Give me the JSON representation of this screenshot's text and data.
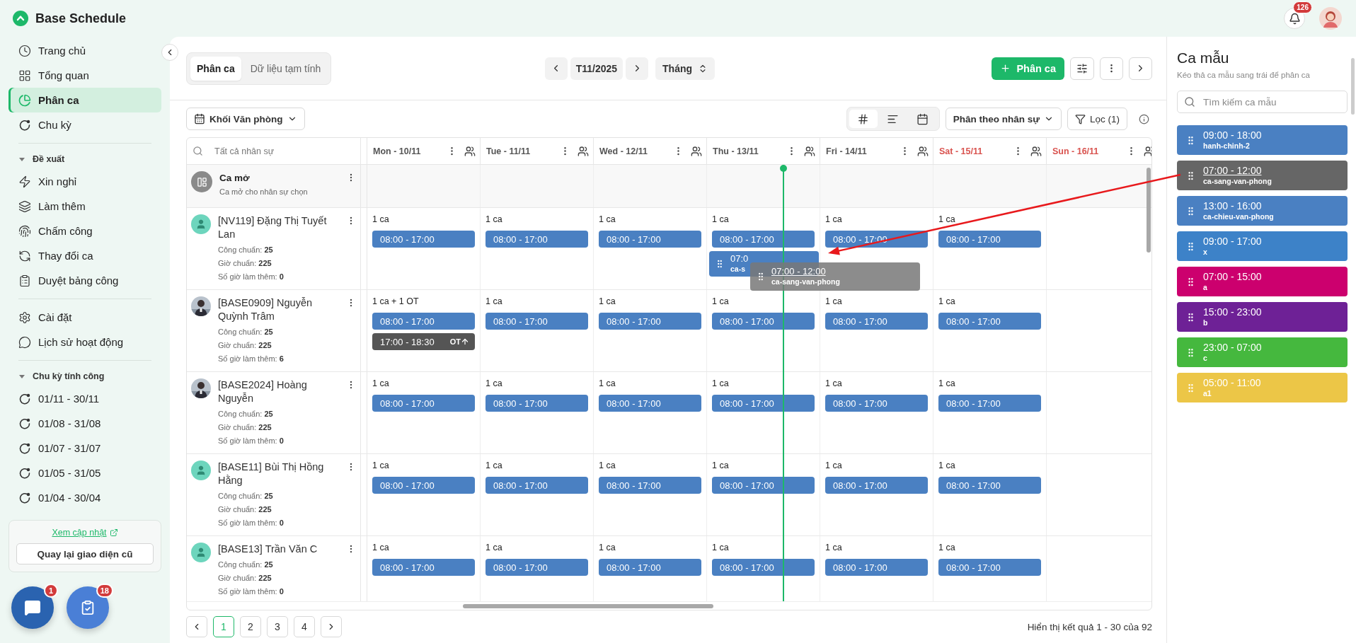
{
  "header": {
    "logo": "Base Schedule",
    "notifications": "126"
  },
  "sidebar": {
    "sections": [
      {
        "items": [
          {
            "label": "Trang chủ",
            "kind": "clock",
            "selected": false
          },
          {
            "label": "Tổng quan",
            "kind": "grid",
            "selected": false
          },
          {
            "label": "Phân ca",
            "kind": "pie",
            "selected": true
          },
          {
            "label": "Chu kỳ",
            "kind": "cycle",
            "selected": false
          }
        ]
      },
      {
        "heading": "Đề xuất",
        "expanded": true,
        "items": [
          {
            "label": "Xin nghỉ",
            "kind": "zap",
            "selected": false
          },
          {
            "label": "Làm thêm",
            "kind": "layers",
            "selected": false
          },
          {
            "label": "Chấm công",
            "kind": "id",
            "selected": false
          },
          {
            "label": "Thay đổi ca",
            "kind": "swap",
            "selected": false
          },
          {
            "label": "Duyệt bảng công",
            "kind": "sheet",
            "selected": false
          }
        ]
      },
      {
        "items": [
          {
            "label": "Cài đặt",
            "kind": "gear",
            "selected": false
          },
          {
            "label": "Lịch sử hoạt động",
            "kind": "chat",
            "selected": false
          }
        ]
      },
      {
        "heading": "Chu kỳ tính công",
        "expanded": true,
        "items": [
          {
            "label": "01/11 - 30/11",
            "kind": "cycle",
            "selected": false
          },
          {
            "label": "01/08 - 31/08",
            "kind": "cycle",
            "selected": false
          },
          {
            "label": "01/07 - 31/07",
            "kind": "cycle",
            "selected": false
          },
          {
            "label": "01/05 - 31/05",
            "kind": "cycle",
            "selected": false
          },
          {
            "label": "01/04 - 30/04",
            "kind": "cycle",
            "selected": false
          }
        ]
      }
    ],
    "update_box": {
      "link": "Xem cập nhật",
      "button": "Quay lại giao diện cũ"
    },
    "fabs": [
      {
        "kind": "chat",
        "badge": "1"
      },
      {
        "kind": "tasks",
        "badge": "18"
      }
    ]
  },
  "toolbar": {
    "tabs": [
      {
        "label": "Phân ca",
        "selected": true
      },
      {
        "label": "Dữ liệu tạm tính",
        "selected": false
      }
    ],
    "period": "T11/2025",
    "view": "Tháng",
    "add_button": "Phân ca"
  },
  "filters": {
    "group": "Khối Văn phòng",
    "view_modes": [
      {
        "kind": "grid",
        "selected": true
      },
      {
        "kind": "timeline",
        "selected": false
      },
      {
        "kind": "calendar",
        "selected": false
      }
    ],
    "assign_mode": "Phân theo nhân sự",
    "filter": "Lọc (1)"
  },
  "grid": {
    "search_placeholder": "Tất cả nhân sự",
    "days": [
      {
        "label": "Mon - 10/11",
        "weekend": false
      },
      {
        "label": "Tue - 11/11",
        "weekend": false
      },
      {
        "label": "Wed - 12/11",
        "weekend": false
      },
      {
        "label": "Thu - 13/11",
        "weekend": false
      },
      {
        "label": "Fri - 14/11",
        "weekend": false
      },
      {
        "label": "Sat - 15/11",
        "weekend": true
      },
      {
        "label": "Sun - 16/11",
        "weekend": true
      }
    ],
    "open_shift": {
      "title": "Ca mở",
      "subtitle": "Ca mở cho nhân sự chọn"
    },
    "employees": [
      {
        "name": "[NV119] Đặng Thị Tuyết Lan",
        "kind": "icon",
        "stats": [
          {
            "label": "Công chuẩn:",
            "value": "25"
          },
          {
            "label": "Giờ chuẩn:",
            "value": "225"
          },
          {
            "label": "Số giờ làm thêm:",
            "value": "0"
          }
        ],
        "cells": [
          {
            "summary": "1 ca",
            "shifts": [
              {
                "kind": "regular",
                "time": "08:00 - 17:00"
              }
            ]
          },
          {
            "summary": "1 ca",
            "shifts": [
              {
                "kind": "regular",
                "time": "08:00 - 17:00"
              }
            ]
          },
          {
            "summary": "1 ca",
            "shifts": [
              {
                "kind": "regular",
                "time": "08:00 - 17:00"
              }
            ]
          },
          {
            "summary": "1 ca",
            "shifts": [
              {
                "kind": "regular",
                "time": "08:00 - 17:00"
              },
              {
                "kind": "drop",
                "time": "07:0",
                "code": "ca-s"
              }
            ]
          },
          {
            "summary": "1 ca",
            "shifts": [
              {
                "kind": "regular",
                "time": "08:00 - 17:00"
              }
            ]
          },
          {
            "summary": "1 ca",
            "shifts": [
              {
                "kind": "regular",
                "time": "08:00 - 17:00"
              }
            ]
          }
        ]
      },
      {
        "name": "[BASE0909] Nguyễn Quỳnh Trâm",
        "stats": [
          {
            "label": "Công chuẩn:",
            "value": "25"
          },
          {
            "label": "Giờ chuẩn:",
            "value": "225"
          },
          {
            "label": "Số giờ làm thêm:",
            "value": "6"
          }
        ],
        "cells": [
          {
            "summary": "1 ca + 1 OT",
            "shifts": [
              {
                "kind": "regular",
                "time": "08:00 - 17:00"
              },
              {
                "kind": "ot",
                "time": "17:00 - 18:30",
                "badge": "OT"
              }
            ]
          },
          {
            "summary": "1 ca",
            "shifts": [
              {
                "kind": "regular",
                "time": "08:00 - 17:00"
              }
            ]
          },
          {
            "summary": "1 ca",
            "shifts": [
              {
                "kind": "regular",
                "time": "08:00 - 17:00"
              }
            ]
          },
          {
            "summary": "1 ca",
            "shifts": [
              {
                "kind": "regular",
                "time": "08:00 - 17:00"
              }
            ]
          },
          {
            "summary": "1 ca",
            "shifts": [
              {
                "kind": "regular",
                "time": "08:00 - 17:00"
              }
            ]
          },
          {
            "summary": "1 ca",
            "shifts": [
              {
                "kind": "regular",
                "time": "08:00 - 17:00"
              }
            ]
          }
        ]
      },
      {
        "name": "[BASE2024] Hoàng Nguyễn",
        "stats": [
          {
            "label": "Công chuẩn:",
            "value": "25"
          },
          {
            "label": "Giờ chuẩn:",
            "value": "225"
          },
          {
            "label": "Số giờ làm thêm:",
            "value": "0"
          }
        ],
        "cells": [
          {
            "summary": "1 ca",
            "shifts": [
              {
                "kind": "regular",
                "time": "08:00 - 17:00"
              }
            ]
          },
          {
            "summary": "1 ca",
            "shifts": [
              {
                "kind": "regular",
                "time": "08:00 - 17:00"
              }
            ]
          },
          {
            "summary": "1 ca",
            "shifts": [
              {
                "kind": "regular",
                "time": "08:00 - 17:00"
              }
            ]
          },
          {
            "summary": "1 ca",
            "shifts": [
              {
                "kind": "regular",
                "time": "08:00 - 17:00"
              }
            ]
          },
          {
            "summary": "1 ca",
            "shifts": [
              {
                "kind": "regular",
                "time": "08:00 - 17:00"
              }
            ]
          },
          {
            "summary": "1 ca",
            "shifts": [
              {
                "kind": "regular",
                "time": "08:00 - 17:00"
              }
            ]
          }
        ]
      },
      {
        "name": "[BASE11] Bùi Thị Hồng Hằng",
        "kind": "icon",
        "stats": [
          {
            "label": "Công chuẩn:",
            "value": "25"
          },
          {
            "label": "Giờ chuẩn:",
            "value": "225"
          },
          {
            "label": "Số giờ làm thêm:",
            "value": "0"
          }
        ],
        "cells": [
          {
            "summary": "1 ca",
            "shifts": [
              {
                "kind": "regular",
                "time": "08:00 - 17:00"
              }
            ]
          },
          {
            "summary": "1 ca",
            "shifts": [
              {
                "kind": "regular",
                "time": "08:00 - 17:00"
              }
            ]
          },
          {
            "summary": "1 ca",
            "shifts": [
              {
                "kind": "regular",
                "time": "08:00 - 17:00"
              }
            ]
          },
          {
            "summary": "1 ca",
            "shifts": [
              {
                "kind": "regular",
                "time": "08:00 - 17:00"
              }
            ]
          },
          {
            "summary": "1 ca",
            "shifts": [
              {
                "kind": "regular",
                "time": "08:00 - 17:00"
              }
            ]
          },
          {
            "summary": "1 ca",
            "shifts": [
              {
                "kind": "regular",
                "time": "08:00 - 17:00"
              }
            ]
          }
        ]
      },
      {
        "name": "[BASE13] Trần Văn C",
        "kind": "icon",
        "stats": [
          {
            "label": "Công chuẩn:",
            "value": "25"
          },
          {
            "label": "Giờ chuẩn:",
            "value": "225"
          },
          {
            "label": "Số giờ làm thêm:",
            "value": "0"
          }
        ],
        "cells": [
          {
            "summary": "1 ca",
            "shifts": [
              {
                "kind": "regular",
                "time": "08:00 - 17:00"
              }
            ]
          },
          {
            "summary": "1 ca",
            "shifts": [
              {
                "kind": "regular",
                "time": "08:00 - 17:00"
              }
            ]
          },
          {
            "summary": "1 ca",
            "shifts": [
              {
                "kind": "regular",
                "time": "08:00 - 17:00"
              }
            ]
          },
          {
            "summary": "1 ca",
            "shifts": [
              {
                "kind": "regular",
                "time": "08:00 - 17:00"
              }
            ]
          },
          {
            "summary": "1 ca",
            "shifts": [
              {
                "kind": "regular",
                "time": "08:00 - 17:00"
              }
            ]
          },
          {
            "summary": "1 ca",
            "shifts": [
              {
                "kind": "regular",
                "time": "08:00 - 17:00"
              }
            ]
          }
        ]
      }
    ],
    "drag_preview": {
      "time": "07:00 - 12:00",
      "code": "ca-sang-van-phong"
    }
  },
  "pagination": {
    "pages": [
      {
        "label": "1",
        "selected": true
      },
      {
        "label": "2",
        "selected": false
      },
      {
        "label": "3",
        "selected": false
      },
      {
        "label": "4",
        "selected": false
      }
    ],
    "summary": "Hiển thị kết quả 1 - 30 của 92"
  },
  "templates": {
    "title": "Ca mẫu",
    "subtitle": "Kéo thả ca mẫu sang trái để phân ca",
    "search_placeholder": "Tìm kiếm ca mẫu",
    "items": [
      {
        "time": "09:00 - 18:00",
        "code": "hanh-chinh-2",
        "color": "#4a80c2",
        "dragging": false
      },
      {
        "time": "07:00 - 12:00",
        "code": "ca-sang-van-phong",
        "color": "#666666",
        "dragging": true
      },
      {
        "time": "13:00 - 16:00",
        "code": "ca-chieu-van-phong",
        "color": "#4a80c2",
        "dragging": false
      },
      {
        "time": "09:00 - 17:00",
        "code": "x",
        "color": "#3d82c8",
        "dragging": false
      },
      {
        "time": "07:00 - 15:00",
        "code": "a",
        "color": "#cc006e",
        "dragging": false
      },
      {
        "time": "15:00 - 23:00",
        "code": "b",
        "color": "#6e2196",
        "dragging": false
      },
      {
        "time": "23:00 - 07:00",
        "code": "c",
        "color": "#45b83e",
        "dragging": false
      },
      {
        "time": "05:00 - 11:00",
        "code": "a1",
        "color": "#ecc647",
        "dragging": false
      }
    ]
  }
}
